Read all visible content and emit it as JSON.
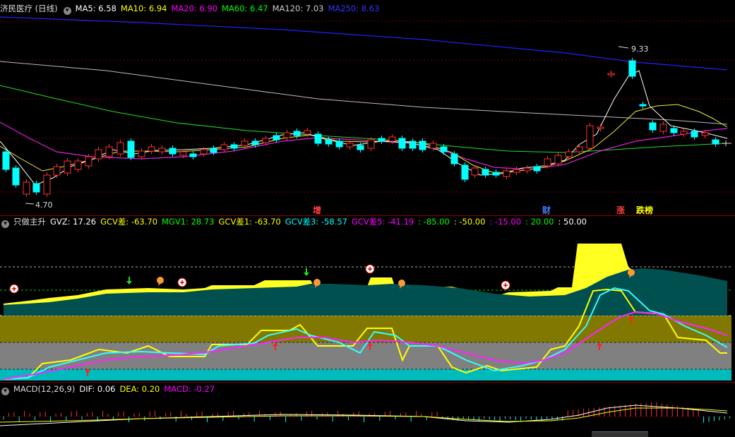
{
  "main_panel": {
    "title": "济民医疗 (日线)",
    "indicators": [
      {
        "label": "MA5: 6.58",
        "color": "#ffffff"
      },
      {
        "label": "MA10: 6.94",
        "color": "#ffff00"
      },
      {
        "label": "MA20: 6.90",
        "color": "#ff00ff"
      },
      {
        "label": "MA60: 6.47",
        "color": "#00ff00"
      },
      {
        "label": "MA120: 7.03",
        "color": "#cccccc"
      },
      {
        "label": "MA250: 8.63",
        "color": "#3333ff"
      }
    ],
    "high_label": "9.33",
    "low_label": "4.70",
    "annotations": [
      {
        "text": "增",
        "color": "#ff4040"
      },
      {
        "text": "财",
        "color": "#4080ff"
      },
      {
        "text": "涨",
        "color": "#ff4040"
      },
      {
        "text": "跌榜",
        "color": "#ffff00"
      }
    ]
  },
  "sub_panel": {
    "title": "只做主升",
    "indicators": [
      {
        "label": "GVZ: 17.26",
        "color": "#ffffff"
      },
      {
        "label": "GCV差: -63.70",
        "color": "#ffff00"
      },
      {
        "label": "MGV1: 28.73",
        "color": "#00ff00"
      },
      {
        "label": "GCV差1: -63.70",
        "color": "#ffff00"
      },
      {
        "label": "GCV差3: -58.57",
        "color": "#00ffff"
      },
      {
        "label": "GCV差5: -41.19",
        "color": "#ff00ff"
      },
      {
        "label": ": -85.00",
        "color": "#00ff00"
      },
      {
        "label": ": -50.00",
        "color": "#ffff00"
      },
      {
        "label": ": -15.00",
        "color": "#ff00ff"
      },
      {
        "label": ": 20.00",
        "color": "#00ff00"
      },
      {
        "label": ": 50.00",
        "color": "#ffffff"
      }
    ]
  },
  "macd_panel": {
    "title": "MACD(12,26,9)",
    "indicators": [
      {
        "label": "DIF: 0.06",
        "color": "#ffffff"
      },
      {
        "label": "DEA: 0.20",
        "color": "#ffff00"
      },
      {
        "label": "MACD: -0.27",
        "color": "#ff00ff"
      }
    ]
  },
  "colors": {
    "up": "#ff3030",
    "down": "#00ffff",
    "grid": "#8b0000",
    "background": "#000000"
  }
}
